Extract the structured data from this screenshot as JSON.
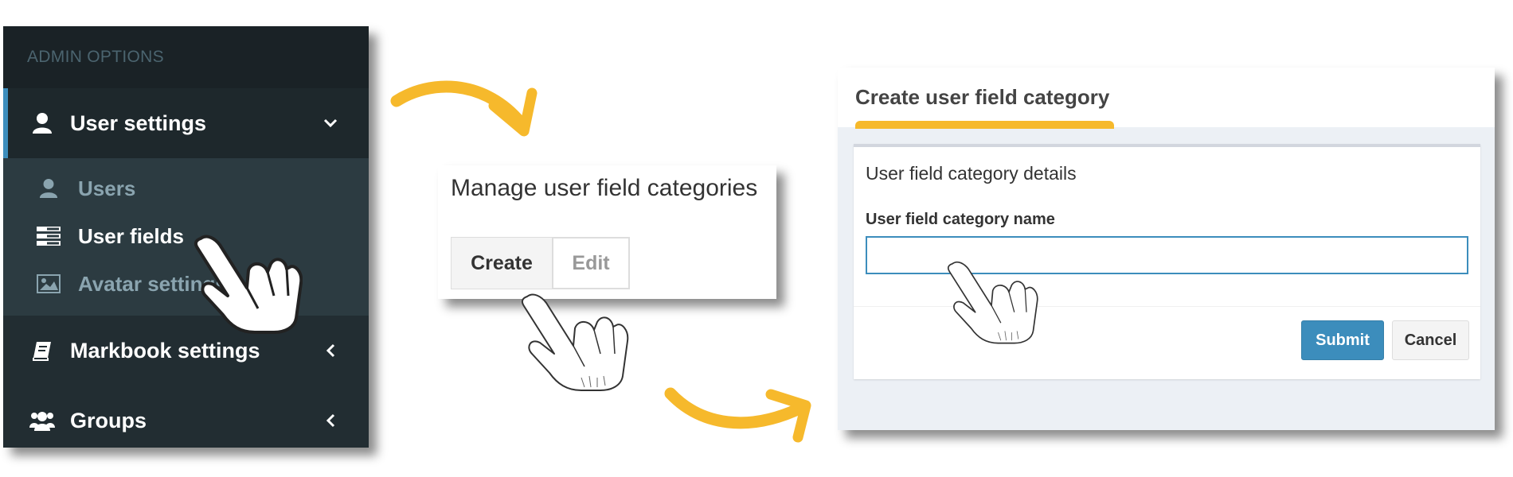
{
  "colors": {
    "sidebar_bg": "#222d32",
    "sidebar_header_bg": "#1a2226",
    "accent_blue": "#3c8dbc",
    "flow_arrow": "#f6b92c"
  },
  "sidebar": {
    "header": "ADMIN OPTIONS",
    "items": [
      {
        "label": "User settings",
        "icon": "user-icon",
        "expanded": true,
        "submenu": [
          {
            "label": "Users",
            "icon": "user-icon"
          },
          {
            "label": "User fields",
            "icon": "list-icon"
          },
          {
            "label": "Avatar settings",
            "icon": "image-icon"
          }
        ]
      },
      {
        "label": "Markbook settings",
        "icon": "book-icon"
      },
      {
        "label": "Groups",
        "icon": "users-icon"
      }
    ]
  },
  "manage_panel": {
    "title": "Manage user field categories",
    "create_label": "Create",
    "edit_label": "Edit"
  },
  "create_panel": {
    "title": "Create user field category",
    "box_title": "User field category details",
    "field_label": "User field category name",
    "field_value": "",
    "submit_label": "Submit",
    "cancel_label": "Cancel"
  }
}
